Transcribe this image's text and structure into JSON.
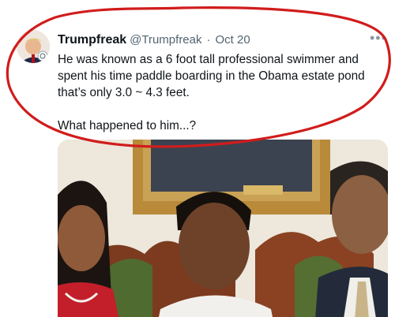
{
  "tweet": {
    "display_name": "Trumpfreak",
    "handle": "@Trumpfreak",
    "separator": "·",
    "date": "Oct 20",
    "more_icon": "more-horizontal-icon",
    "text_line1": "He was known as a 6 foot tall professional swimmer and spent his time paddle boarding in the Obama estate pond that’s only 3.0 ~ 4.3 feet.",
    "text_line2": "What happened to him...?"
  },
  "colors": {
    "text_primary": "#0f1419",
    "text_secondary": "#536471",
    "annotation_red": "#d11c1c"
  }
}
